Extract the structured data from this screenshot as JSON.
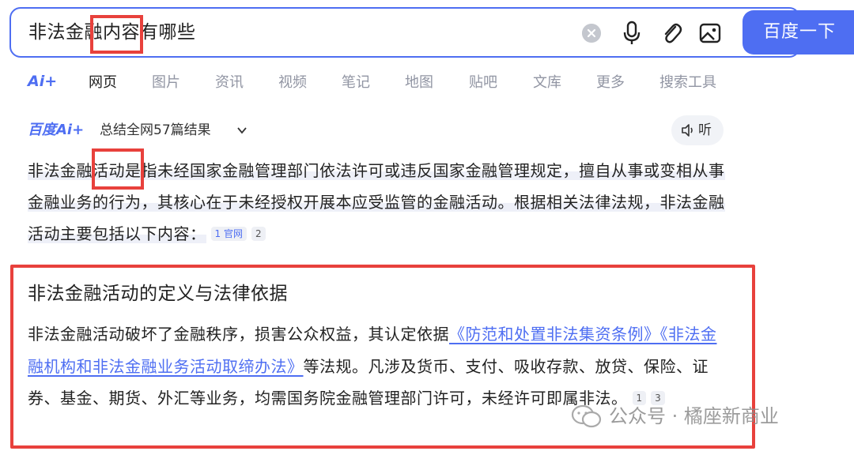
{
  "search": {
    "query": "非法金融内容有哪些",
    "button_label": "百度一下"
  },
  "tabs": {
    "ai_label": "Ai+",
    "items": [
      "网页",
      "图片",
      "资讯",
      "视频",
      "笔记",
      "地图",
      "贴吧",
      "文库",
      "更多",
      "搜索工具"
    ]
  },
  "summary": {
    "brand": "百度Ai+",
    "meta": "总结全网57篇结果",
    "listen_label": "听"
  },
  "paragraph1": {
    "text": "非法金融活动是指未经国家金融管理部门依法许可或违反国家金融管理规定，擅自从事或变相从事金融业务的行为，其核心在于未经授权开展本应受监管的金融活动。根据相关法律法规，非法金融活动主要包括以下内容：",
    "cite1": "1 官网",
    "cite2": "2"
  },
  "section": {
    "title": "非法金融活动的定义与法律依据",
    "part1": "非法金融活动破坏了金融秩序，损害公众权益，其认定依据",
    "law1": "《防范和处置非法集资条例》",
    "law2": "《非法金融机构和非法金融业务活动取缔办法》",
    "part2": "等法规。凡涉及货币、支付、吸收存款、放贷、保险、证券、基金、期货、外汇等业务，均需国务院金融管理部门许可，未经许可即属非法。",
    "cite1": "1",
    "cite2": "3"
  },
  "watermark": {
    "text": "公众号 · 橘座新商业"
  },
  "colors": {
    "accent": "#4e6ef2",
    "annotation": "#e8413c"
  }
}
